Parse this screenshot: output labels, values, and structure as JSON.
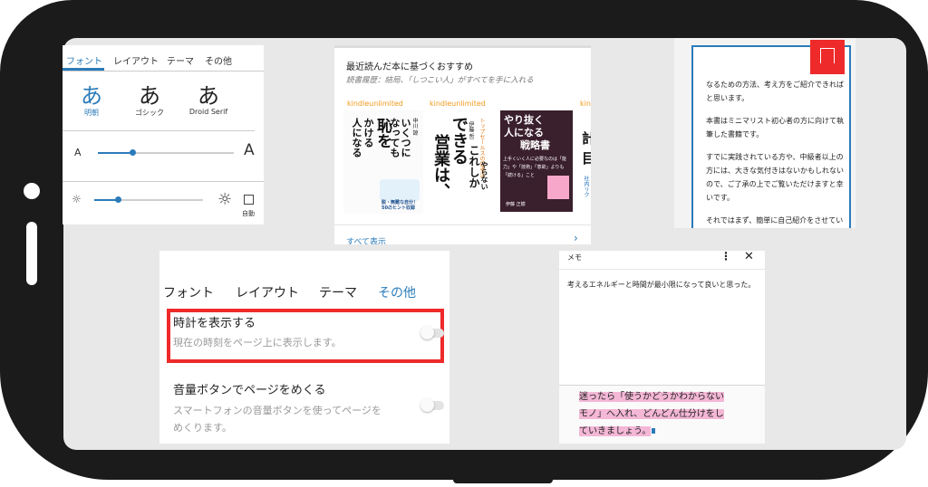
{
  "panel_font": {
    "tabs": [
      "フォント",
      "レイアウト",
      "テーマ",
      "その他"
    ],
    "fonts": [
      {
        "glyph": "あ",
        "label": "明朝"
      },
      {
        "glyph": "あ",
        "label": "ゴシック"
      },
      {
        "glyph": "あ",
        "label": "Droid Serif"
      }
    ],
    "size_small": "A",
    "size_large": "A",
    "auto_label": "自動",
    "font_size_level": 0.25,
    "brightness_level": 0.22
  },
  "panel_recommend": {
    "title": "最近読んだ本に基づくおすすめ",
    "subtitle": "読書履歴：結局、「しつこい人」がすべてを手に入れる",
    "badge": "kindleunlimited",
    "see_all": "すべて表示",
    "books": [
      {
        "title_lines": [
          "いくつに",
          "なっても",
          "恥を",
          "かける",
          "人になる"
        ],
        "author": "中川 諒",
        "note": "脱・無難な自分！50のヒント収録"
      },
      {
        "title_lines": [
          "できる",
          "営業は、",
          "これしか",
          "やらない"
        ],
        "author": "伊藤 哲",
        "note": "トップセールスの思考法"
      },
      {
        "title_lines": [
          "やり抜く",
          "人になる",
          "戦略書"
        ],
        "author": "伊藤 正樹",
        "note": "上手くいく人に必要なのは「能力」や「技術」「意欲」よりも「続ける」こと"
      },
      {
        "title_lines": [
          "計",
          "目"
        ],
        "author": "",
        "note": "社内リク"
      }
    ]
  },
  "panel_reader": {
    "paragraphs": [
      "なるための方法、考え方をご紹介できればと思います。",
      "本書はミニマリスト初心者の方に向けて執筆した書籍です。",
      "すでに実践されている方や、中級者以上の方には、大きな気付きはないかもしれないので、ご了承の上でご覧いただけますと幸いです。",
      "それではまず、簡単に自己紹介をさせていただければと思います。"
    ]
  },
  "panel_settings": {
    "tabs": [
      "フォント",
      "レイアウト",
      "テーマ",
      "その他"
    ],
    "clock_title": "時計を表示する",
    "clock_desc": "現在の時刻をページ上に表示します。",
    "volume_title": "音量ボタンでページをめくる",
    "volume_desc": "スマートフォンの音量ボタンを使ってページをめくります。",
    "accent": "#2b7bb9",
    "highlight": "#ee2a2a"
  },
  "panel_memo": {
    "title": "メモ",
    "note_text": "考えるエネルギーと時間が最小限になって良いと思った。",
    "highlight_text": "迷ったら「使うかどうかわからないモノ」へ入れ、どんどん仕分けをしていきましょう。",
    "highlight_color": "#f4b7d6"
  }
}
